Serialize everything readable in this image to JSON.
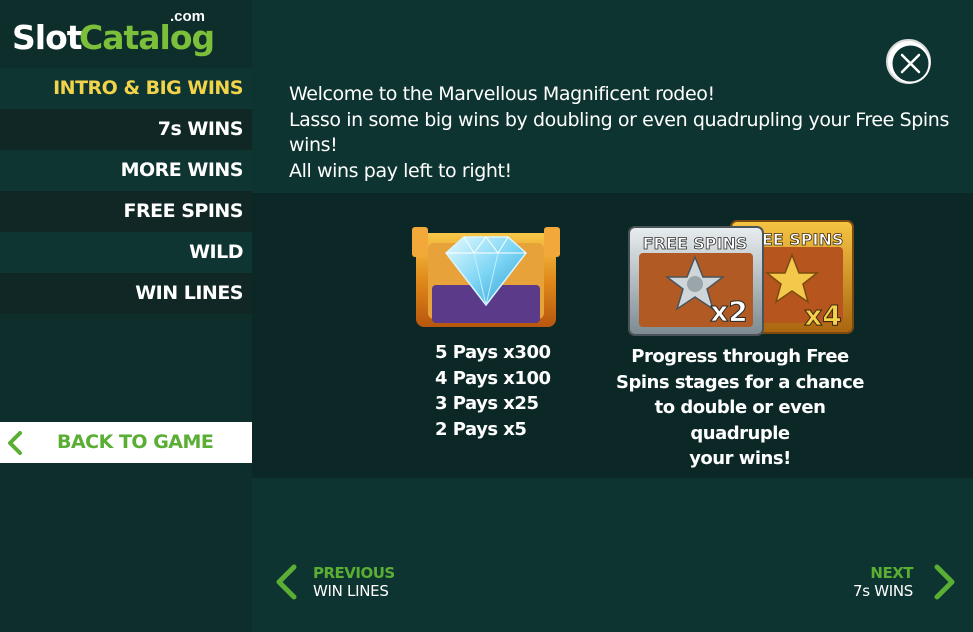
{
  "logo": {
    "slot": "Slot",
    "catalog": "Catalog",
    "com": ".com"
  },
  "sidebar": {
    "items": [
      {
        "label": "INTRO & BIG WINS",
        "active": true
      },
      {
        "label": "7s WINS"
      },
      {
        "label": "MORE WINS"
      },
      {
        "label": "FREE SPINS"
      },
      {
        "label": "WILD"
      },
      {
        "label": "WIN LINES"
      }
    ],
    "back_label": "BACK TO GAME"
  },
  "main": {
    "intro_lines": [
      "Welcome to the Marvellous Magnificent rodeo!",
      "Lasso in some big wins by doubling or even quadrupling your Free Spins wins!",
      "All wins pay left to right!"
    ],
    "pays": [
      "5 Pays x300",
      "4 Pays x100",
      "3 Pays x25",
      "2 Pays x5"
    ],
    "free_spins_badges": {
      "label1": "FREE SPINS",
      "mult1": "x2",
      "label2": "FREE SPINS",
      "mult2": "x4"
    },
    "free_spins_text": [
      "Progress through Free",
      "Spins stages for a chance",
      "to double or even quadruple",
      "your wins!"
    ]
  },
  "footer": {
    "prev_label": "PREVIOUS",
    "prev_target": "WIN LINES",
    "next_label": "NEXT",
    "next_target": "7s WINS"
  },
  "colors": {
    "background": "#0e3431",
    "sidebar_bg": "#112725",
    "active_text": "#f2d44a",
    "accent_green": "#5aae34",
    "logo_green": "#7bbf3a"
  }
}
